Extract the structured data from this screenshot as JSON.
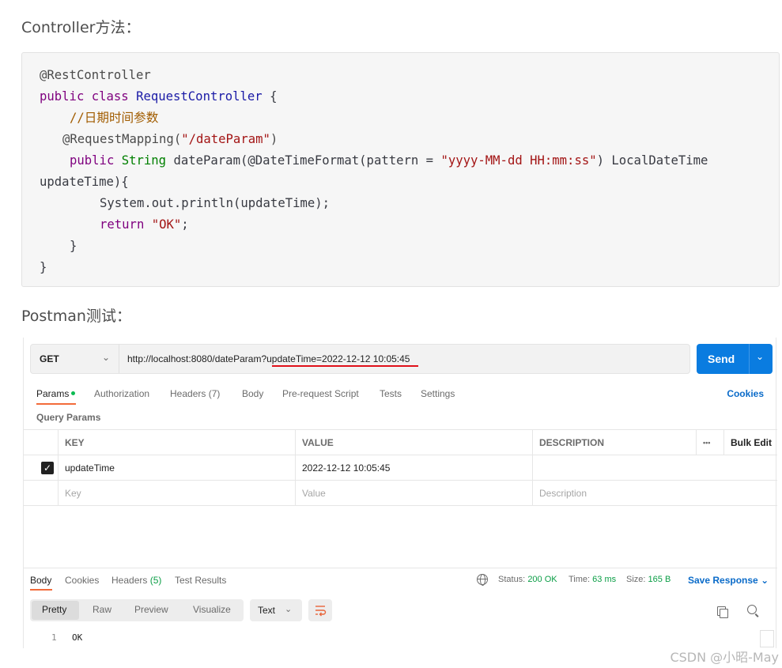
{
  "headings": {
    "controller": "Controller方法：",
    "postman": "Postman测试："
  },
  "code": {
    "l1_ann": "@RestController",
    "l2_public": "public",
    "l2_class": "class",
    "l2_name": "RequestController",
    "l2_brace": " {",
    "l3_comment": "//日期时间参数",
    "l4_ann": "@RequestMapping(",
    "l4_str": "\"/dateParam\"",
    "l4_end": ")",
    "l5_public": "public",
    "l5_type": "String",
    "l5_sig": " dateParam(@DateTimeFormat(pattern = ",
    "l5_str": "\"yyyy-MM-dd HH:mm:ss\"",
    "l5_end": ") LocalDateTime",
    "l6": "updateTime){",
    "l7": "System.out.println(updateTime);",
    "l8_return": "return",
    "l8_str": "\"OK\"",
    "l8_end": ";",
    "l9": "}",
    "l10": "}"
  },
  "request": {
    "method": "GET",
    "url": "http://localhost:8080/dateParam?updateTime=2022-12-12 10:05:45",
    "send_label": "Send"
  },
  "tabs": {
    "params": "Params",
    "authorization": "Authorization",
    "headers": "Headers (7)",
    "body": "Body",
    "prerequest": "Pre-request Script",
    "tests": "Tests",
    "settings": "Settings",
    "cookies": "Cookies"
  },
  "query_params": {
    "title": "Query Params",
    "headers": {
      "key": "KEY",
      "value": "VALUE",
      "description": "DESCRIPTION",
      "more": "•••",
      "bulk_edit": "Bulk Edit"
    },
    "rows": [
      {
        "key": "updateTime",
        "value": "2022-12-12 10:05:45",
        "description": ""
      }
    ],
    "placeholders": {
      "key": "Key",
      "value": "Value",
      "description": "Description"
    }
  },
  "response": {
    "tabs": {
      "body": "Body",
      "cookies": "Cookies",
      "headers": "Headers",
      "headers_count": "(5)",
      "test_results": "Test Results"
    },
    "status_label": "Status:",
    "status_value": "200 OK",
    "time_label": "Time:",
    "time_value": "63 ms",
    "size_label": "Size:",
    "size_value": "165 B",
    "save_response": "Save Response",
    "views": {
      "pretty": "Pretty",
      "raw": "Raw",
      "preview": "Preview",
      "visualize": "Visualize"
    },
    "format": "Text",
    "line_number": "1",
    "line_text": "OK"
  },
  "watermark": "CSDN @小昭-May"
}
